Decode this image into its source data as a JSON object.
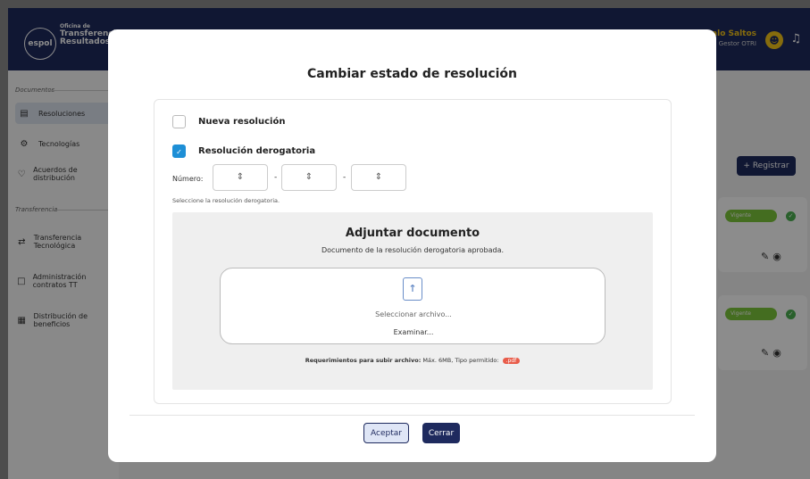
{
  "header": {
    "logo_mark": "espol",
    "logo_line1": "Oficina de",
    "logo_line2": "Transferencia",
    "logo_line3": "Resultados d",
    "user_name": "valo Saltos",
    "user_role": "Gestor OTRI",
    "avatar_icon": "user-icon",
    "bell_icon": "bell-icon"
  },
  "sidebar": {
    "section_documentos": "Documentos",
    "section_transferencia": "Transferencia",
    "items": [
      {
        "label": "Resoluciones",
        "icon": "document-icon"
      },
      {
        "label": "Tecnologías",
        "icon": "gear-icon"
      },
      {
        "label": "Acuerdos de distribución",
        "icon": "handshake-icon"
      },
      {
        "label": "Transferencia Tecnológica",
        "icon": "exchange-icon"
      },
      {
        "label": "Administración contratos TT",
        "icon": "folder-icon"
      },
      {
        "label": "Distribución de beneficios",
        "icon": "money-icon"
      }
    ]
  },
  "main": {
    "register_button": "+ Registrar",
    "cards": [
      {
        "status": "Vigente"
      },
      {
        "status": "Vigente"
      }
    ]
  },
  "modal": {
    "title": "Cambiar estado de resolución",
    "option_new": "Nueva resolución",
    "option_derog": "Resolución derogatoria",
    "option_derog_checked": true,
    "numero_label": "Número:",
    "dash": "-",
    "hint": "Seleccione la resolución derogatoria.",
    "attach_title": "Adjuntar documento",
    "attach_subtitle": "Documento de la resolución derogatoria aprobada.",
    "select_file": "Seleccionar archivo...",
    "browse": "Examinar...",
    "req_label": "Requerimientos para subir archivo:",
    "req_text": "Máx. 6MB, Tipo permitido:",
    "req_type": ".pdf",
    "accept_button": "Aceptar",
    "close_button": "Cerrar"
  },
  "colors": {
    "primary": "#1e2a5e",
    "accent": "#f5c518",
    "checkbox": "#1e8fd6",
    "status": "#7dc63b",
    "pdf_tag": "#e85c4a"
  }
}
